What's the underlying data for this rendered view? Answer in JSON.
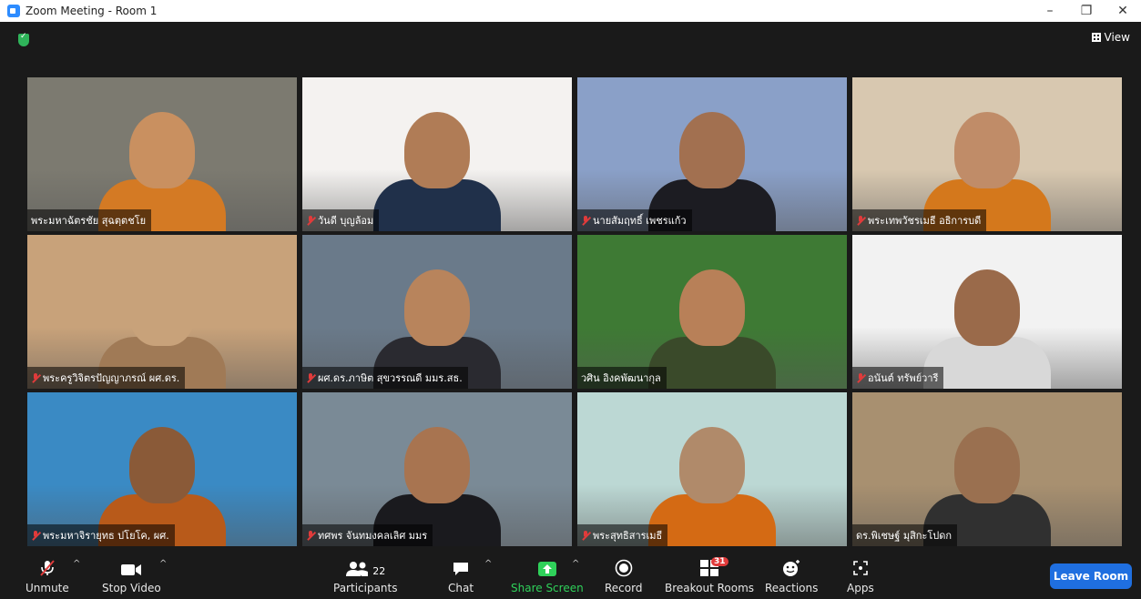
{
  "window": {
    "title": "Zoom Meeting - Room 1"
  },
  "header": {
    "view_label": "View"
  },
  "participants_grid": [
    {
      "name": "พระมหาฉัตรชัย สุฉตฺตชโย",
      "muted": false,
      "bg": "#7c7a70",
      "skin": "#c99060",
      "cloth": "#d47a24",
      "active": false
    },
    {
      "name": "วันดี บุญล้อม",
      "muted": true,
      "bg": "#f4f2f0",
      "skin": "#b07c56",
      "cloth": "#20304a",
      "active": false
    },
    {
      "name": "นายสัมฤทธิ์ เพชรแก้ว",
      "muted": true,
      "bg": "#8aa0c8",
      "skin": "#a27050",
      "cloth": "#1c1c22",
      "active": false
    },
    {
      "name": "พระเทพวัชรเมธี อธิการบดี",
      "muted": true,
      "bg": "#d8c8b0",
      "skin": "#c08c68",
      "cloth": "#d4781c",
      "active": false
    },
    {
      "name": "พระครูวิจิตรปัญญาภรณ์ ผศ.ดร.",
      "muted": true,
      "bg": "#c8a27a",
      "skin": "#c8a27a",
      "cloth": "#a07a56",
      "active": false
    },
    {
      "name": "ผศ.ดร.ภาษิต สุขวรรณดี มมร.สธ.",
      "muted": true,
      "bg": "#6a7a8a",
      "skin": "#b8845c",
      "cloth": "#2a2a30",
      "active": false
    },
    {
      "name": "วศิน อิงคพัฒนากุล",
      "muted": false,
      "bg": "#3e7a34",
      "skin": "#b88058",
      "cloth": "#3a4a2a",
      "active": false
    },
    {
      "name": "อนันต์ ทรัพย์วารี",
      "muted": true,
      "bg": "#f2f2f2",
      "skin": "#9a6a4a",
      "cloth": "#d8d8d8",
      "active": false
    },
    {
      "name": "พระมหาจิรายุทธ ปโยโค, ผศ.",
      "muted": true,
      "bg": "#3a8ac4",
      "skin": "#8a5a38",
      "cloth": "#b85a1a",
      "active": false
    },
    {
      "name": "ทศพร จันทมงคลเลิศ มมร",
      "muted": true,
      "bg": "#7a8a96",
      "skin": "#a87450",
      "cloth": "#1a1a1e",
      "active": false
    },
    {
      "name": "พระสุทธิสารเมธี",
      "muted": true,
      "bg": "#bcd8d4",
      "skin": "#b08a6a",
      "cloth": "#d46a14",
      "active": false
    },
    {
      "name": "ดร.พิเชษฐ์ มุสิกะโปดก",
      "muted": false,
      "bg": "#a89070",
      "skin": "#9a7050",
      "cloth": "#303030",
      "active": true
    }
  ],
  "toolbar": {
    "unmute": "Unmute",
    "stop_video": "Stop Video",
    "participants": "Participants",
    "participants_count": "22",
    "chat": "Chat",
    "share_screen": "Share Screen",
    "record": "Record",
    "breakout_rooms": "Breakout Rooms",
    "breakout_count": "31",
    "reactions": "Reactions",
    "apps": "Apps",
    "leave": "Leave Room"
  },
  "colors": {
    "share_green": "#2fd15a",
    "leave_blue": "#1f6fe0",
    "active_outline": "#e8ec5c"
  }
}
